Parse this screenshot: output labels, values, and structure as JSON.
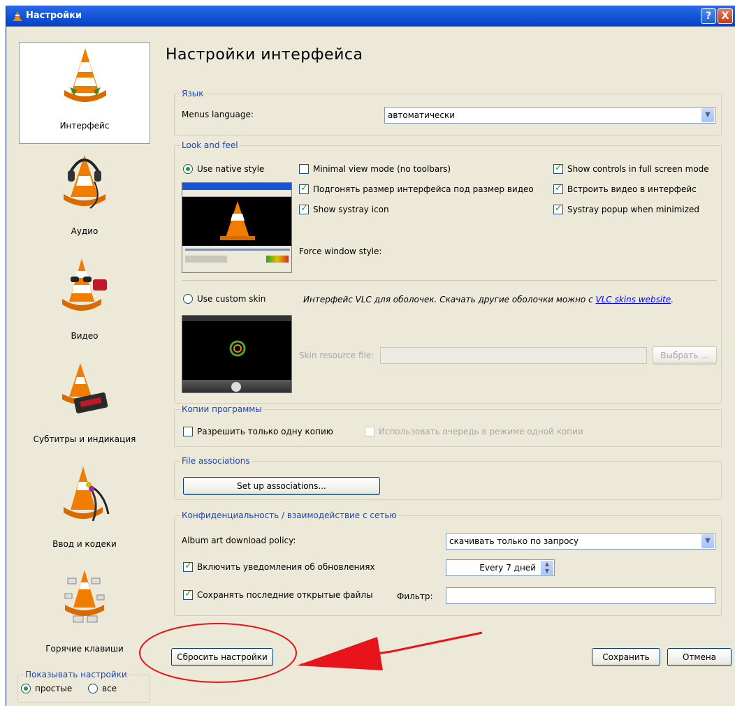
{
  "window": {
    "title": "Настройки",
    "help_button": "?",
    "close_button": "X"
  },
  "sidebar": {
    "items": [
      {
        "label": "Интерфейс",
        "icon": "vlc-cone-interface-icon",
        "selected": true
      },
      {
        "label": "Аудио",
        "icon": "vlc-cone-headphones-icon",
        "selected": false
      },
      {
        "label": "Видео",
        "icon": "vlc-cone-glasses-icon",
        "selected": false
      },
      {
        "label": "Субтитры и индикация",
        "icon": "vlc-cone-subtitles-icon",
        "selected": false
      },
      {
        "label": "Ввод и кодеки",
        "icon": "vlc-cone-cables-icon",
        "selected": false
      },
      {
        "label": "Горячие клавиши",
        "icon": "vlc-cone-keyboard-icon",
        "selected": false
      }
    ],
    "show_settings": {
      "legend": "Показывать настройки",
      "simple": "простые",
      "all": "все",
      "selected": "простые"
    }
  },
  "main": {
    "heading": "Настройки интерфейса",
    "language": {
      "legend": "Язык",
      "menus_language_label": "Menus language:",
      "menus_language_value": "автоматически"
    },
    "look_and_feel": {
      "legend": "Look and feel",
      "native_style": "Use native style",
      "minimal_view": "Minimal view mode (no toolbars)",
      "show_controls_fullscreen": "Show controls in full screen mode",
      "resize_interface": "Подгонять размер интерфейса под размер видео",
      "embed_video": "Встроить видео в интерфейс",
      "systray_icon": "Show systray icon",
      "systray_popup": "Systray popup when minimized",
      "force_window_style": "Force window style:",
      "custom_skin": "Use custom skin",
      "skin_note": "Интерфейс VLC для оболочек. Скачать другие оболочки можно с ",
      "skin_link": "VLC skins website",
      "skin_note_end": ".",
      "skin_resource_label": "Skin resource file:",
      "choose_button": "Выбрать ...",
      "checks": {
        "minimal_view": false,
        "show_controls_fullscreen": true,
        "resize_interface": true,
        "embed_video": true,
        "systray_icon": true,
        "systray_popup": true
      }
    },
    "instances": {
      "legend": "Копии программы",
      "one_instance": "Разрешить только одну копию",
      "enqueue": "Использовать очередь в режиме одной копии"
    },
    "file_assoc": {
      "legend": "File associations",
      "button": "Set up associations..."
    },
    "privacy": {
      "legend": "Конфиденциальность / взаимодействие с сетью",
      "album_art_label": "Album art download policy:",
      "album_art_value": "скачивать только по запросу",
      "update_notify": "Включить уведомления об обновлениях",
      "update_value": "Every 7 дней",
      "save_recent": "Сохранять последние открытые файлы",
      "filter_label": "Фильтр:",
      "filter_value": ""
    }
  },
  "footer": {
    "reset_button": "Сбросить настройки",
    "save_button": "Сохранить",
    "cancel_button": "Отмена"
  },
  "annotation": {
    "color": "#e8141c"
  }
}
